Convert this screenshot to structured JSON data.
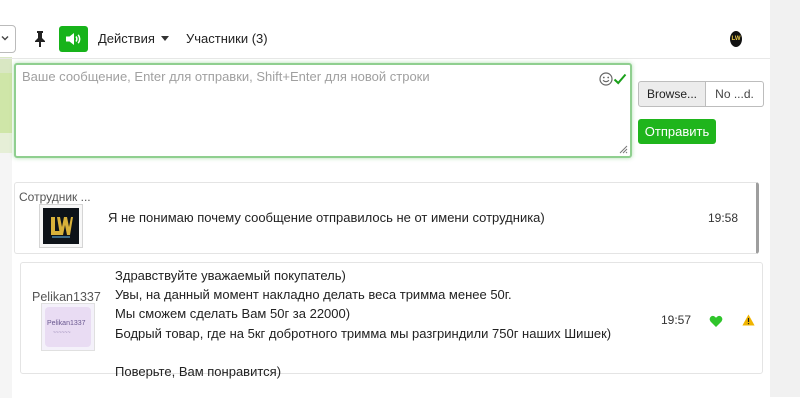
{
  "toolbar": {
    "actions_label": "Действия",
    "participants_label": "Участники (3)",
    "sound_enabled": true,
    "accent_color": "#17b31a"
  },
  "composer": {
    "placeholder": "Ваше сообщение, Enter для отправки, Shift+Enter для новой строки",
    "value": "",
    "browse_label": "Browse...",
    "file_label": "No ...d.",
    "send_label": "Отправить"
  },
  "messages": [
    {
      "author": "Сотрудник ...",
      "text": "Я не понимаю почему сообщение отправилось не от имени сотрудника)",
      "time": "19:58"
    },
    {
      "author": "Pelikan1337",
      "avatar_label": "Pelikan1337",
      "lines": [
        "Здравствуйте уважаемый покупатель)",
        "Увы, на данный момент накладно делать веса тримма менее 50г.",
        "Мы сможем сделать Вам 50г за 22000)",
        "Бодрый товар, где на 5кг добротного тримма мы разгриндили 750г наших Шишек)",
        "",
        "Поверьте, Вам понравится)"
      ],
      "time": "19:57",
      "liked": true,
      "warn_color": "#f0b400",
      "like_color": "#2fc52b"
    }
  ]
}
